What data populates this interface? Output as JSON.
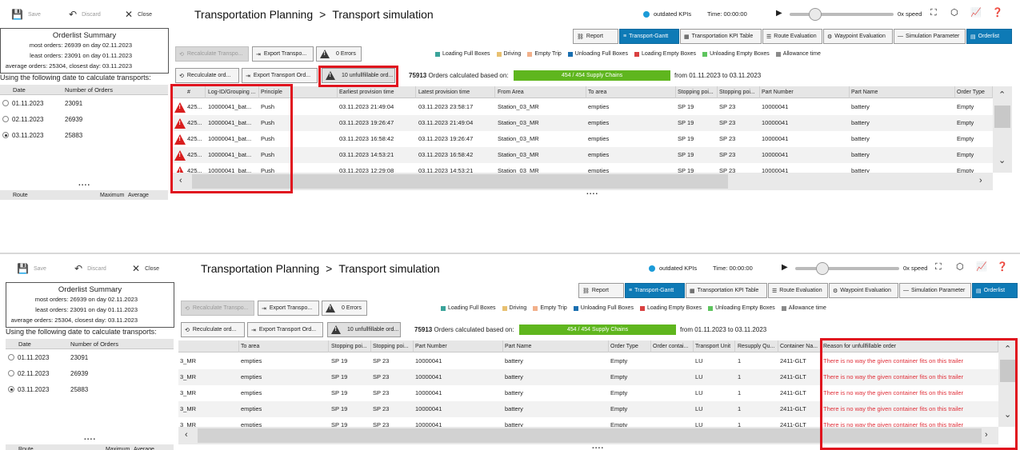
{
  "toolbar": {
    "save": "Save",
    "discard": "Discard",
    "close": "Close"
  },
  "header": {
    "title": "Transportation Planning",
    "separator": ">",
    "subtitle": "Transport simulation",
    "kpi_status": "outdated KPIs",
    "time_label": "Time: 00:00:00",
    "speed": "0x speed"
  },
  "summary": {
    "heading": "Orderlist Summary",
    "most": "most orders: 26939 on day 02.11.2023",
    "least": "least orders: 23091 on day 01.11.2023",
    "average": "average orders: 25304, closest day: 03.11.2023"
  },
  "using_label": "Using the following date to calculate transports:",
  "date_table": {
    "headers": [
      "Date",
      "Number of Orders"
    ],
    "rows": [
      {
        "date": "01.11.2023",
        "count": "23091",
        "selected": false
      },
      {
        "date": "02.11.2023",
        "count": "26939",
        "selected": false
      },
      {
        "date": "03.11.2023",
        "count": "25883",
        "selected": true
      }
    ]
  },
  "route_table": {
    "headers": [
      "Route",
      "Maximum",
      "Average"
    ]
  },
  "dots": "....",
  "buttons": {
    "recalc_transports": "Recalculate Transpo...",
    "export_transports": "Export Transpo...",
    "errors": "0 Errors",
    "recalc_orders": "Reculculate ord...",
    "export_orders": "Export Transport Ord...",
    "unfulfillable": "10 unfullfillable ord..."
  },
  "tabs": [
    "Report",
    "Transport-Gantt",
    "Transportation KPI Table",
    "Route Evaluation",
    "Waypoint Evaluation",
    "Simulation Parameter",
    "Orderlist"
  ],
  "legend": [
    {
      "label": "Loading Full Boxes",
      "color": "#3aa39a"
    },
    {
      "label": "Driving",
      "color": "#e8c070"
    },
    {
      "label": "Empty Trip",
      "color": "#f2b08a"
    },
    {
      "label": "Unloading Full Boxes",
      "color": "#1a6fb0"
    },
    {
      "label": "Loading Empty Boxes",
      "color": "#d94040"
    },
    {
      "label": "Unloading Empty Boxes",
      "color": "#5ec45e"
    },
    {
      "label": "Allowance time",
      "color": "#8a8a8a"
    }
  ],
  "orders": {
    "count": "75913",
    "text": "Orders calculated based on:",
    "bar": "454 / 454 Supply Chains",
    "range": "from 01.11.2023 to 03.11.2023"
  },
  "grid_top": {
    "headers": [
      "#",
      "Log-ID/Grouping ...",
      "Principle",
      "Earliest provision time",
      "Latest provision time",
      "From Area",
      "To area",
      "Stopping poi...",
      "Stopping poi...",
      "Part Number",
      "Part Name",
      "Order Type"
    ],
    "rows": [
      [
        "425...",
        "10000041_bat...",
        "Push",
        "03.11.2023 21:49:04",
        "03.11.2023 23:58:17",
        "Station_03_MR",
        "empties",
        "SP 19",
        "SP 23",
        "10000041",
        "battery",
        "Empty"
      ],
      [
        "425...",
        "10000041_bat...",
        "Push",
        "03.11.2023 19:26:47",
        "03.11.2023 21:49:04",
        "Station_03_MR",
        "empties",
        "SP 19",
        "SP 23",
        "10000041",
        "battery",
        "Empty"
      ],
      [
        "425...",
        "10000041_bat...",
        "Push",
        "03.11.2023 16:58:42",
        "03.11.2023 19:26:47",
        "Station_03_MR",
        "empties",
        "SP 19",
        "SP 23",
        "10000041",
        "battery",
        "Empty"
      ],
      [
        "425...",
        "10000041_bat...",
        "Push",
        "03.11.2023 14:53:21",
        "03.11.2023 16:58:42",
        "Station_03_MR",
        "empties",
        "SP 19",
        "SP 23",
        "10000041",
        "battery",
        "Empty"
      ],
      [
        "425...",
        "10000041_bat...",
        "Push",
        "03.11.2023 12:29:08",
        "03.11.2023 14:53:21",
        "Station_03_MR",
        "empties",
        "SP 19",
        "SP 23",
        "10000041",
        "battery",
        "Empty"
      ]
    ]
  },
  "grid_bottom": {
    "headers": [
      "",
      "To area",
      "Stopping poi...",
      "Stopping poi...",
      "Part Number",
      "Part Name",
      "Order Type",
      "Order contai...",
      "Transport Unit",
      "Resupply Qu...",
      "Container Na...",
      "Reason for unfullfillable order"
    ],
    "rows": [
      [
        "3_MR",
        "empties",
        "SP 19",
        "SP 23",
        "10000041",
        "battery",
        "Empty",
        "",
        "LU",
        "1",
        "2411-GLT",
        "There is no way the given container fits on this trailer"
      ],
      [
        "3_MR",
        "empties",
        "SP 19",
        "SP 23",
        "10000041",
        "battery",
        "Empty",
        "",
        "LU",
        "1",
        "2411-GLT",
        "There is no way the given container fits on this trailer"
      ],
      [
        "3_MR",
        "empties",
        "SP 19",
        "SP 23",
        "10000041",
        "battery",
        "Empty",
        "",
        "LU",
        "1",
        "2411-GLT",
        "There is no way the given container fits on this trailer"
      ],
      [
        "3_MR",
        "empties",
        "SP 19",
        "SP 23",
        "10000041",
        "battery",
        "Empty",
        "",
        "LU",
        "1",
        "2411-GLT",
        "There is no way the given container fits on this trailer"
      ],
      [
        "3_MR",
        "empties",
        "SP 19",
        "SP 23",
        "10000041",
        "battery",
        "Empty",
        "",
        "LU",
        "1",
        "2411-GLT",
        "There is no way the given container fits on this trailer"
      ]
    ]
  },
  "colors": {
    "accent": "#0e7ab6",
    "highlight": "#e0121e",
    "warning": "#d91e1e",
    "progress": "#5fb61e",
    "error_text": "#e0303a"
  },
  "progress": {
    "supply_chains_fraction": 1.0
  }
}
